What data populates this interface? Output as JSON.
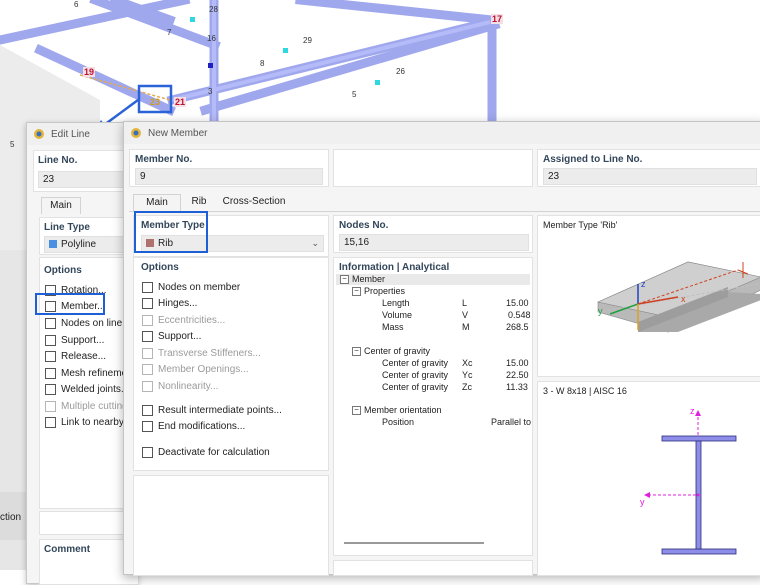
{
  "scene": {
    "node_labels": [
      "6",
      "7",
      "28",
      "16",
      "29",
      "8",
      "26",
      "5",
      "3",
      "5"
    ],
    "red_labels": [
      "17",
      "19",
      "21"
    ],
    "selected_node": "23",
    "left_edge_text": "ction"
  },
  "edit_line": {
    "title": "Edit Line",
    "line_no_label": "Line No.",
    "line_no_value": "23",
    "tab_main": "Main",
    "line_type_label": "Line Type",
    "line_type_value": "Polyline",
    "line_type_color": "#4a90e2",
    "options_label": "Options",
    "options": [
      {
        "label": "Rotation...",
        "disabled": false
      },
      {
        "label": "Member...",
        "disabled": false
      },
      {
        "label": "Nodes on line...",
        "disabled": false
      },
      {
        "label": "Support...",
        "disabled": false
      },
      {
        "label": "Release...",
        "disabled": false
      },
      {
        "label": "Mesh refinement",
        "disabled": false
      },
      {
        "label": "Welded joints...",
        "disabled": false
      },
      {
        "label": "Multiple cutting l",
        "disabled": true
      },
      {
        "label": "Link to nearby ob",
        "disabled": false
      }
    ],
    "comment_label": "Comment"
  },
  "new_member": {
    "title": "New Member",
    "member_no_label": "Member No.",
    "member_no_value": "9",
    "assigned_label": "Assigned to Line No.",
    "assigned_value": "23",
    "tabs": [
      "Main",
      "Rib",
      "Cross-Section"
    ],
    "member_type_label": "Member Type",
    "member_type_value": "Rib",
    "member_type_color": "#b07070",
    "options_label": "Options",
    "options": [
      {
        "label": "Nodes on member",
        "disabled": false
      },
      {
        "label": "Hinges...",
        "disabled": false
      },
      {
        "label": "Eccentricities...",
        "disabled": true
      },
      {
        "label": "Support...",
        "disabled": false
      },
      {
        "label": "Transverse Stiffeners...",
        "disabled": true
      },
      {
        "label": "Member Openings...",
        "disabled": true
      },
      {
        "label": "Nonlinearity...",
        "disabled": true
      }
    ],
    "options2": [
      {
        "label": "Result intermediate points...",
        "disabled": false
      },
      {
        "label": "End modifications...",
        "disabled": false
      }
    ],
    "deactivate_label": "Deactivate for calculation",
    "nodes_no_label": "Nodes No.",
    "nodes_no_value": "15,16",
    "info_label": "Information | Analytical",
    "info_tree": {
      "member": "Member",
      "properties": "Properties",
      "props": [
        {
          "name": "Length",
          "sym": "L",
          "value": "15.00"
        },
        {
          "name": "Volume",
          "sym": "V",
          "value": "0.548"
        },
        {
          "name": "Mass",
          "sym": "M",
          "value": "268.5"
        }
      ],
      "cog": "Center of gravity",
      "cog_rows": [
        {
          "name": "Center of gravity",
          "sym": "Xc",
          "value": "15.00"
        },
        {
          "name": "Center of gravity",
          "sym": "Yc",
          "value": "22.50"
        },
        {
          "name": "Center of gravity",
          "sym": "Zc",
          "value": "11.33"
        }
      ],
      "orientation": "Member orientation",
      "orientation_rows": [
        {
          "name": "Position",
          "sym": "",
          "value": "Parallel to"
        }
      ]
    },
    "preview_title": "Member Type 'Rib'",
    "section_title": "3 - W 8x18 | AISC 16",
    "axis_labels": {
      "z": "z",
      "y": "y",
      "x": "x"
    }
  }
}
